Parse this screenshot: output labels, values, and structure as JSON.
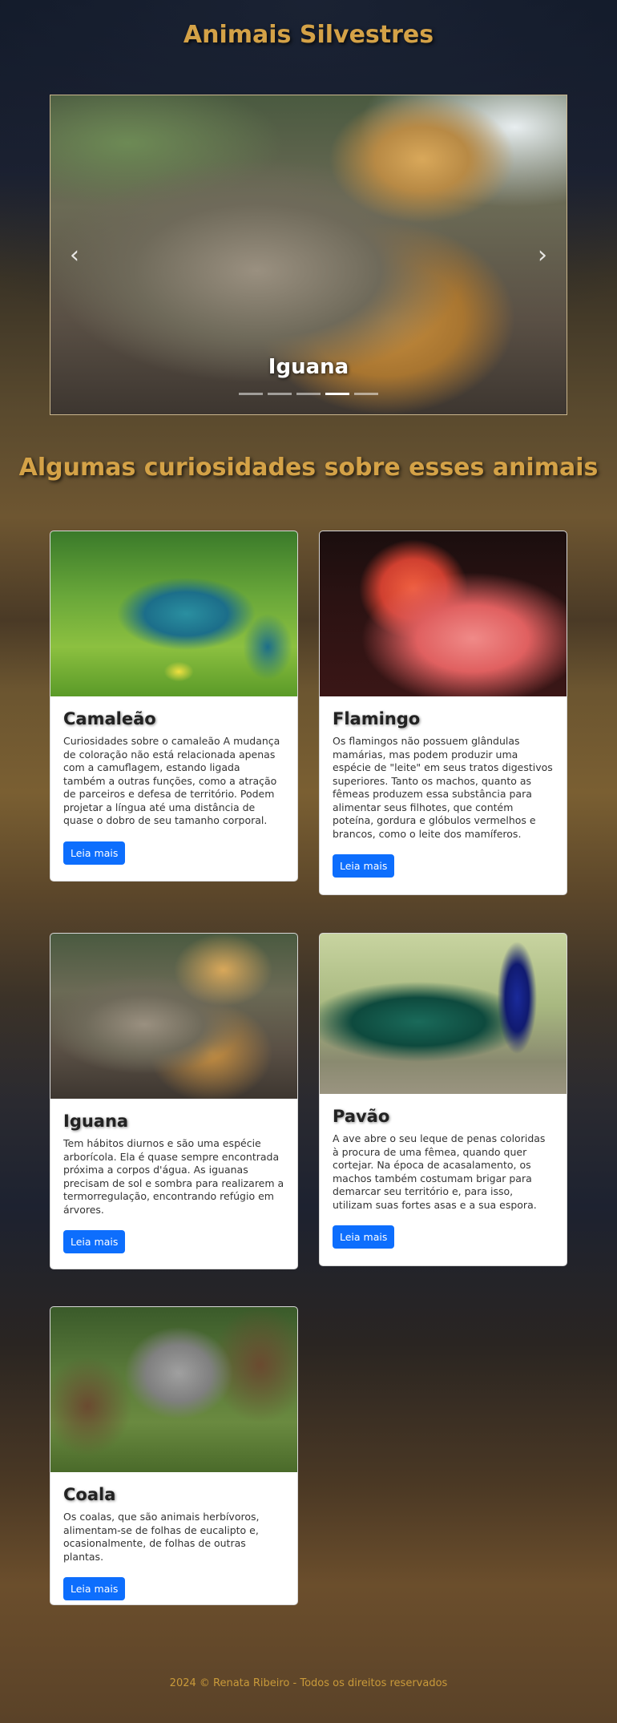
{
  "header": {
    "title": "Animais Silvestres"
  },
  "carousel": {
    "caption": "Iguana",
    "prev_icon": "chevron-left-icon",
    "next_icon": "chevron-right-icon",
    "prev_glyph": "‹",
    "next_glyph": "›",
    "slide_count": 5,
    "active_index": 3
  },
  "section": {
    "title": "Algumas curiosidades sobre esses animais"
  },
  "cards": [
    {
      "title": "Camaleão",
      "text": "Curiosidades sobre o camaleão A mudança de coloração não está relacionada apenas com a camuflagem, estando ligada também a outras funções, como a atração de parceiros e defesa de território. Podem projetar a língua até uma distância de quase o dobro de seu tamanho corporal.",
      "button": "Leia mais"
    },
    {
      "title": "Flamingo",
      "text": "Os flamingos não possuem glândulas mamárias, mas podem produzir uma espécie de \"leite\" em seus tratos digestivos superiores. Tanto os machos, quanto as fêmeas produzem essa substância para alimentar seus filhotes, que contém poteína, gordura e glóbulos vermelhos e brancos, como o leite dos mamíferos.",
      "button": "Leia mais"
    },
    {
      "title": "Iguana",
      "text": "Tem hábitos diurnos e são uma espécie arborícola. Ela é quase sempre encontrada próxima a corpos d'água. As iguanas precisam de sol e sombra para realizarem a termorregulação, encontrando refúgio em árvores.",
      "button": "Leia mais"
    },
    {
      "title": "Pavão",
      "text": "A ave abre o seu leque de penas coloridas à procura de uma fêmea, quando quer cortejar. Na época de acasalamento, os machos também costumam brigar para demarcar seu território e, para isso, utilizam suas fortes asas e a sua espora.",
      "button": "Leia mais"
    },
    {
      "title": "Coala",
      "text": "Os coalas, que são animais herbívoros, alimentam-se de folhas de eucalipto e, ocasionalmente, de folhas de outras plantas.",
      "button": "Leia mais"
    }
  ],
  "footer": {
    "text": "2024 © Renata Ribeiro - Todos os direitos reservados"
  },
  "colors": {
    "accent": "#d4a247",
    "button": "#0d6efd",
    "footer": "#c99a3a"
  }
}
